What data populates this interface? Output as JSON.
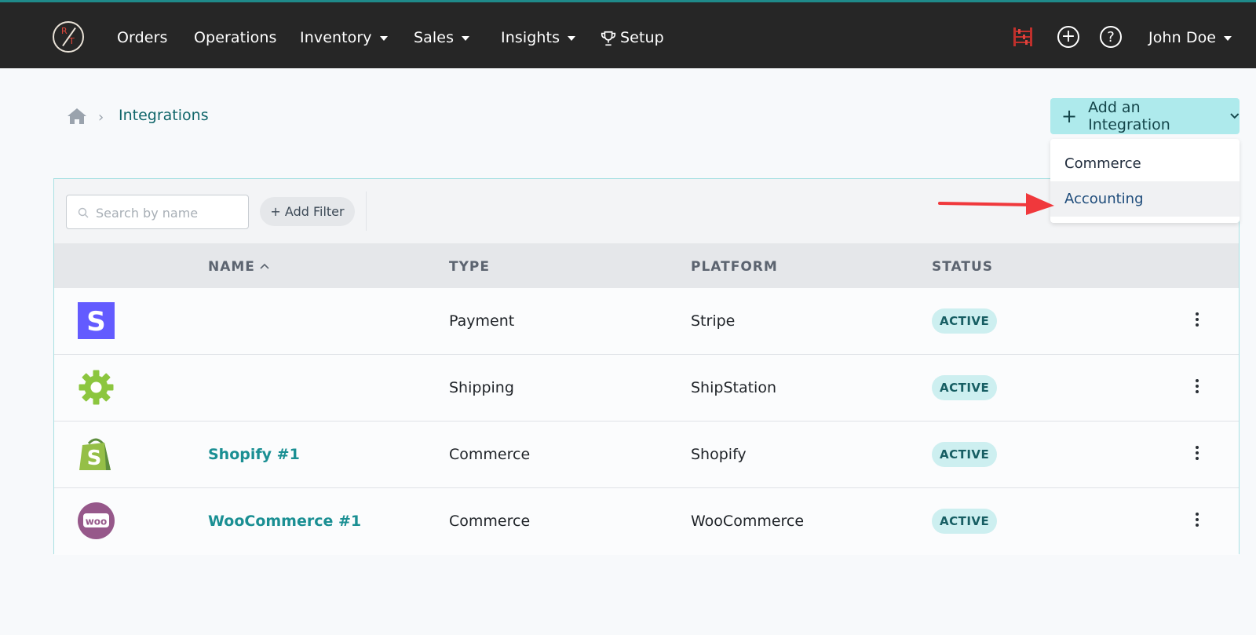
{
  "topnav": {
    "items": [
      {
        "label": "Orders",
        "dropdown": false
      },
      {
        "label": "Operations",
        "dropdown": false
      },
      {
        "label": "Inventory",
        "dropdown": true
      },
      {
        "label": "Sales",
        "dropdown": true
      },
      {
        "label": "Insights",
        "dropdown": true
      },
      {
        "label": "Setup",
        "dropdown": false,
        "icon": "trophy-icon"
      }
    ],
    "user": "John Doe",
    "icons": [
      "abacus-icon",
      "plus-circle-icon",
      "help-icon"
    ],
    "accent_color": "#1f8a8a"
  },
  "breadcrumb": {
    "home_icon": "home-icon",
    "separator": ">",
    "current": "Integrations"
  },
  "add_integration": {
    "label": "Add an Integration",
    "menu": [
      "Commerce",
      "Accounting"
    ],
    "highlighted": "Accounting"
  },
  "toolbar": {
    "search_placeholder": "Search by name",
    "filter_label": "+ Add Filter"
  },
  "table": {
    "columns": [
      "NAME",
      "TYPE",
      "PLATFORM",
      "STATUS"
    ],
    "sort": {
      "column": "NAME",
      "direction": "ascending"
    },
    "rows": [
      {
        "logo": "stripe-logo",
        "name": "",
        "type": "Payment",
        "platform": "Stripe",
        "status": "ACTIVE"
      },
      {
        "logo": "shipstation-logo",
        "name": "",
        "type": "Shipping",
        "platform": "ShipStation",
        "status": "ACTIVE"
      },
      {
        "logo": "shopify-logo",
        "name": "Shopify #1",
        "type": "Commerce",
        "platform": "Shopify",
        "status": "ACTIVE"
      },
      {
        "logo": "woocommerce-logo",
        "name": "WooCommerce #1",
        "type": "Commerce",
        "platform": "WooCommerce",
        "status": "ACTIVE"
      }
    ]
  },
  "annotation": {
    "arrow_color": "#f0383c",
    "points_to": "Accounting"
  },
  "colors": {
    "badge_bg": "#cdeff0",
    "link": "#1a8f93",
    "button_bg": "#aeeaec"
  }
}
